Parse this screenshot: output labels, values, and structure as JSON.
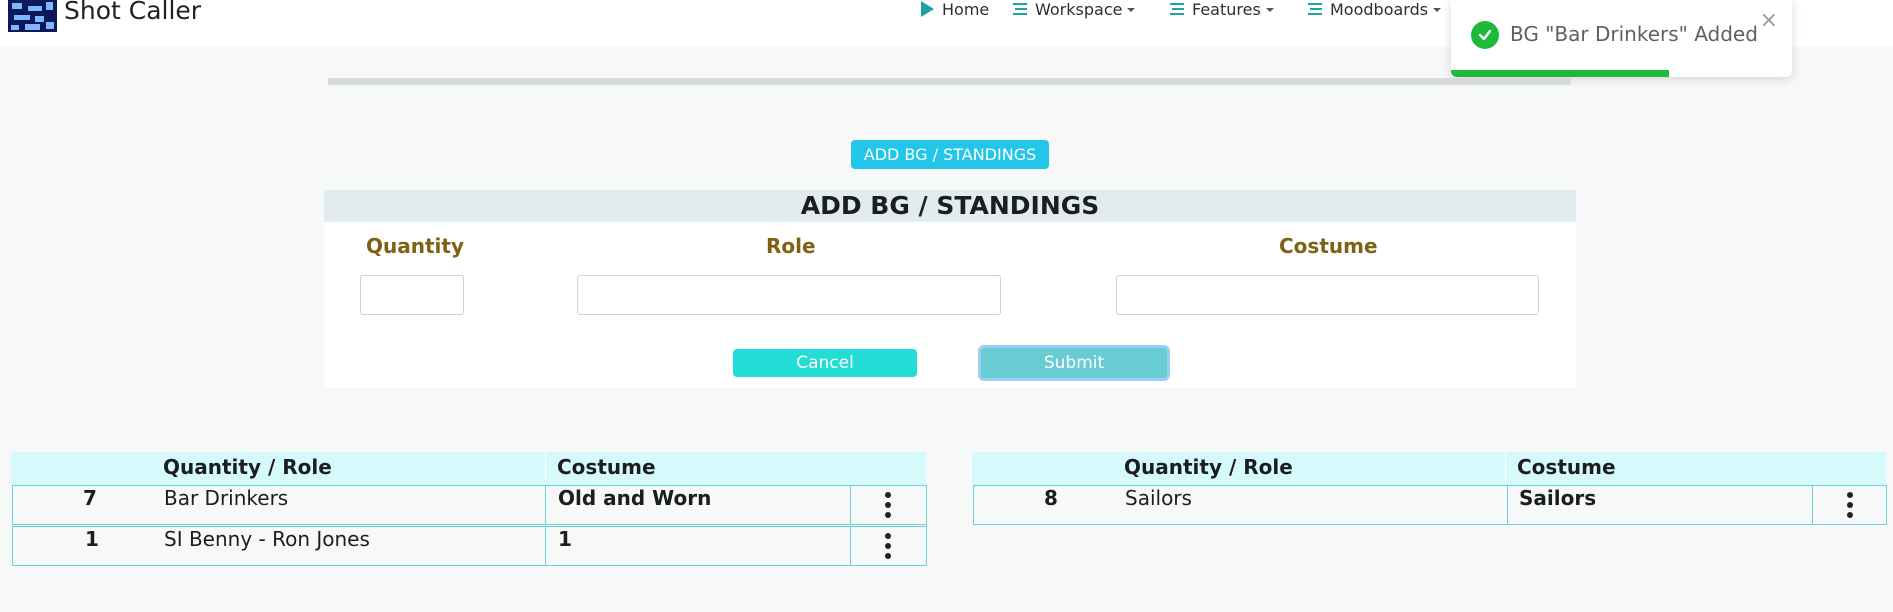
{
  "navbar": {
    "brand": "Shot Caller",
    "items": [
      {
        "label": "Home",
        "icon": "play-icon"
      },
      {
        "label": "Workspace",
        "icon": "list-icon"
      },
      {
        "label": "Features",
        "icon": "list-icon"
      },
      {
        "label": "Moodboards",
        "icon": "list-icon"
      }
    ]
  },
  "toast": {
    "message": "BG \"Bar Drinkers\" Added",
    "close": "×",
    "progress": 0.64,
    "color": "#1db939"
  },
  "add_button": {
    "label": "ADD BG / STANDINGS"
  },
  "form": {
    "title": "ADD BG / STANDINGS",
    "labels": {
      "quantity": "Quantity",
      "role": "Role",
      "costume": "Costume"
    },
    "values": {
      "quantity": "",
      "role": "",
      "costume": ""
    },
    "cancel": "Cancel",
    "submit": "Submit"
  },
  "tables": [
    {
      "headers": {
        "quantity_role": "Quantity / Role",
        "costume": "Costume"
      },
      "rows": [
        {
          "quantity": "7",
          "role": "Bar Drinkers",
          "costume": "Old and Worn"
        },
        {
          "quantity": "1",
          "role": "SI Benny - Ron Jones",
          "costume": "1"
        }
      ]
    },
    {
      "headers": {
        "quantity_role": "Quantity / Role",
        "costume": "Costume"
      },
      "rows": [
        {
          "quantity": "8",
          "role": "Sailors",
          "costume": "Sailors"
        }
      ]
    }
  ],
  "colors": {
    "accent": "#22c6e8",
    "cancel": "#23dcd6",
    "submit": "#69ccd3",
    "label": "#7d6215",
    "table_header": "#d6fafc",
    "table_border": "#6fcfd8"
  }
}
